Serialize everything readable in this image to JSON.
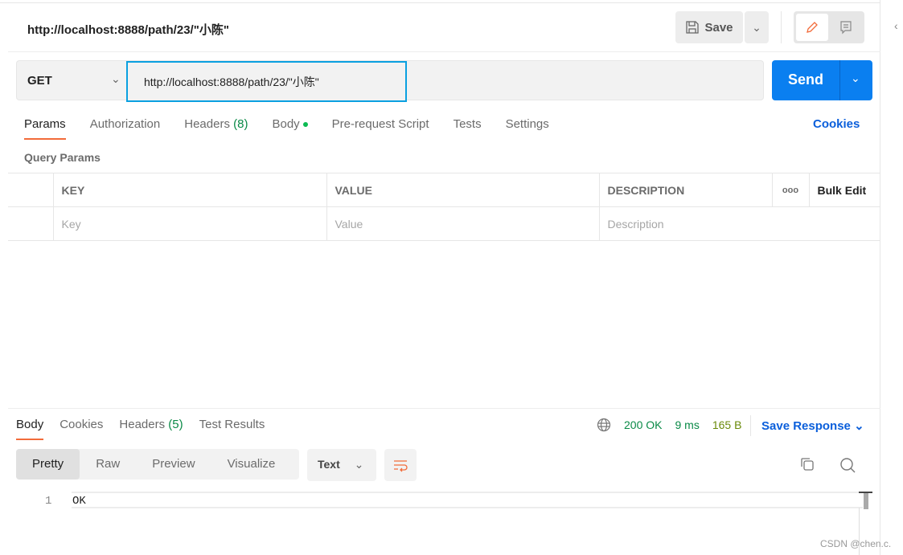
{
  "request": {
    "title": "http://localhost:8888/path/23/\"小陈\"",
    "method": "GET",
    "url": "http://localhost:8888/path/23/\"小陈\""
  },
  "toolbar": {
    "save_label": "Save",
    "send_label": "Send"
  },
  "tabs": [
    {
      "label": "Params"
    },
    {
      "label": "Authorization"
    },
    {
      "label": "Headers",
      "count": "(8)"
    },
    {
      "label": "Body"
    },
    {
      "label": "Pre-request Script"
    },
    {
      "label": "Tests"
    },
    {
      "label": "Settings"
    }
  ],
  "cookies_label": "Cookies",
  "query_params": {
    "title": "Query Params",
    "headers": [
      "KEY",
      "VALUE",
      "DESCRIPTION"
    ],
    "bulk_edit": "Bulk Edit",
    "more": "ooo",
    "placeholders": [
      "Key",
      "Value",
      "Description"
    ]
  },
  "response": {
    "tabs": [
      "Body",
      "Cookies",
      "Headers",
      "Test Results"
    ],
    "headers_count": "(5)",
    "status": "200 OK",
    "time": "9 ms",
    "size": "165 B",
    "save_response": "Save Response",
    "views": [
      "Pretty",
      "Raw",
      "Preview",
      "Visualize"
    ],
    "format": "Text",
    "lines": [
      {
        "no": "1",
        "text": "OK"
      }
    ]
  },
  "watermark": "CSDN @chen.c.",
  "colors": {
    "accent": "#f26b3a",
    "send": "#0a7ff0",
    "link": "#0b5fdb",
    "status": "#0a8a47",
    "focus": "#0aa0e0"
  }
}
